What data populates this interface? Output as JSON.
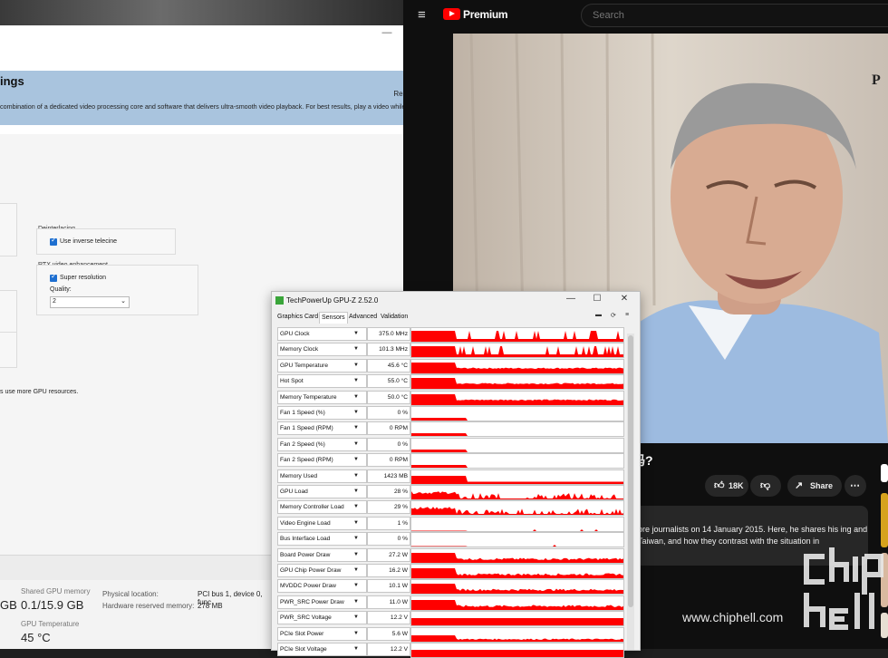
{
  "nvidia": {
    "title": "ings",
    "restore_defaults": "Restore Defaults",
    "description": "combination of a dedicated video processing core and software that delivers ultra-smooth video playback. For best results, play a video while you make adjustments",
    "deinterlacing": {
      "group_label": "Deinterlacing",
      "inverse_telecine": "Use inverse telecine"
    },
    "rtx": {
      "group_label": "RTX video enhancement",
      "super_resolution": "Super resolution",
      "quality_label": "Quality:",
      "quality_value": "2"
    },
    "note": "s use more GPU resources."
  },
  "taskmgr": {
    "shared_label": "Shared GPU memory",
    "shared_value": "0.1/15.9 GB",
    "left_value": "GB",
    "temp_label": "GPU Temperature",
    "temp_value": "45 °C",
    "physical_label": "Physical location:",
    "physical_value": "PCI bus 1, device 0, func",
    "reserved_label": "Hardware reserved memory:",
    "reserved_value": "278 MB"
  },
  "youtube": {
    "brand": "Premium",
    "search_placeholder": "Search",
    "video_title": "吗?",
    "likes": "18K",
    "share": "Share",
    "description": "ore journalists on 14 January 2015. Here, he shares his ing and Taiwan, and how they contrast with the situation in",
    "watermark": "www.chiphell.com",
    "chip_logo": "chip hell",
    "video_corner": "P"
  },
  "gpuz": {
    "title": "TechPowerUp GPU-Z 2.52.0",
    "tabs": [
      "Graphics Card",
      "Sensors",
      "Advanced",
      "Validation"
    ],
    "active_tab": "Sensors",
    "graph_color": "#ff0000",
    "sensors": [
      {
        "name": "GPU Clock",
        "value": "375.0 MHz",
        "pattern": "spiky"
      },
      {
        "name": "Memory Clock",
        "value": "101.3 MHz",
        "pattern": "spiky"
      },
      {
        "name": "GPU Temperature",
        "value": "45.6 °C",
        "pattern": "high"
      },
      {
        "name": "Hot Spot",
        "value": "55.0 °C",
        "pattern": "high"
      },
      {
        "name": "Memory Temperature",
        "value": "50.0 °C",
        "pattern": "high"
      },
      {
        "name": "Fan 1 Speed (%)",
        "value": "0 %",
        "pattern": "early"
      },
      {
        "name": "Fan 1 Speed (RPM)",
        "value": "0 RPM",
        "pattern": "early"
      },
      {
        "name": "Fan 2 Speed (%)",
        "value": "0 %",
        "pattern": "early"
      },
      {
        "name": "Fan 2 Speed (RPM)",
        "value": "0 RPM",
        "pattern": "early"
      },
      {
        "name": "Memory Used",
        "value": "1423 MB",
        "pattern": "step"
      },
      {
        "name": "GPU Load",
        "value": "28 %",
        "pattern": "load"
      },
      {
        "name": "Memory Controller Load",
        "value": "29 %",
        "pattern": "load"
      },
      {
        "name": "Video Engine Load",
        "value": "1 %",
        "pattern": "tiny"
      },
      {
        "name": "Bus Interface Load",
        "value": "0 %",
        "pattern": "tiny"
      },
      {
        "name": "Board Power Draw",
        "value": "27.2 W",
        "pattern": "power"
      },
      {
        "name": "GPU Chip Power Draw",
        "value": "16.2 W",
        "pattern": "power"
      },
      {
        "name": "MVDDC Power Draw",
        "value": "10.1 W",
        "pattern": "power"
      },
      {
        "name": "PWR_SRC Power Draw",
        "value": "11.0 W",
        "pattern": "power"
      },
      {
        "name": "PWR_SRC Voltage",
        "value": "12.2 V",
        "pattern": "full"
      },
      {
        "name": "PCIe Slot Power",
        "value": "5.6 W",
        "pattern": "powerlow"
      },
      {
        "name": "PCIe Slot Voltage",
        "value": "12.2 V",
        "pattern": "full"
      }
    ]
  }
}
